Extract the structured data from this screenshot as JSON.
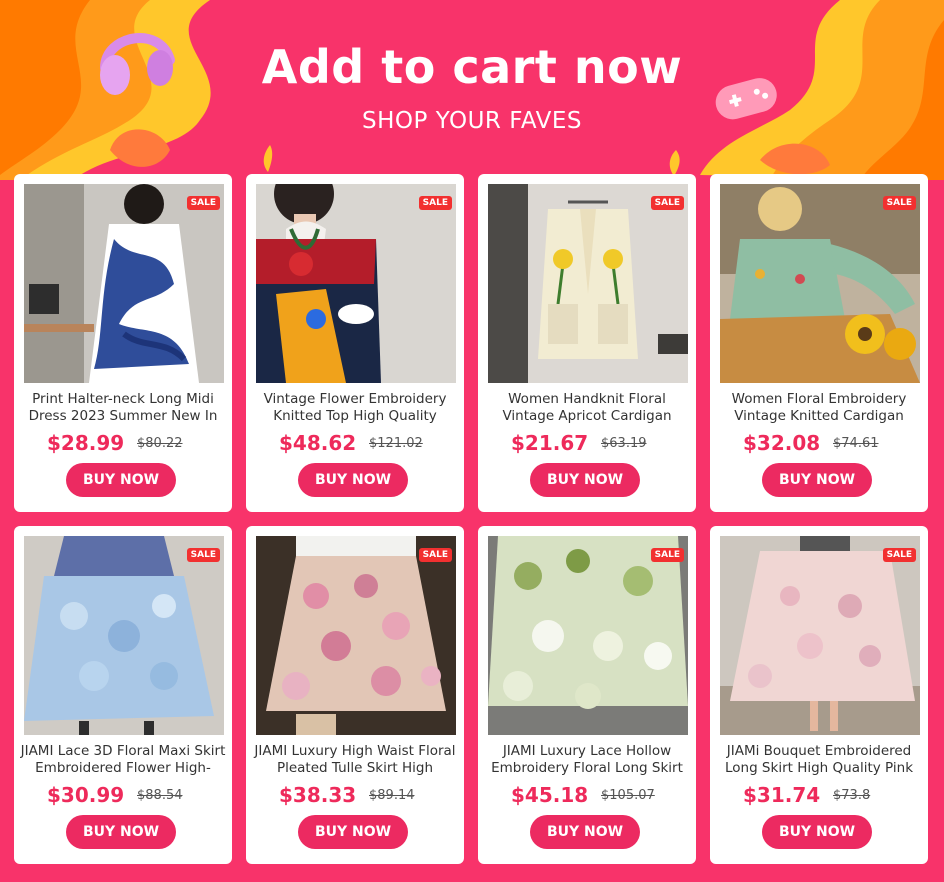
{
  "banner": {
    "title": "Add to cart now",
    "subtitle": "SHOP YOUR FAVES"
  },
  "colors": {
    "background": "#f8336a",
    "accent_orange": "#ff7a00",
    "accent_yellow": "#ffc72b",
    "price_red": "#ee2a5b",
    "button_pink": "#ec2a61"
  },
  "decorations": [
    "headphones-icon",
    "gamepad-icon",
    "leaf-icon"
  ],
  "products": [
    {
      "name": "Print Halter-neck Long Midi Dress 2023 Summer New In",
      "price": "$28.99",
      "old_price": "$80.22",
      "badge": "SALE",
      "button": "BUY NOW"
    },
    {
      "name": "Vintage Flower Embroidery Knitted Top High Quality",
      "price": "$48.62",
      "old_price": "$121.02",
      "badge": "SALE",
      "button": "BUY NOW"
    },
    {
      "name": "Women Handknit Floral Vintage Apricot Cardigan",
      "price": "$21.67",
      "old_price": "$63.19",
      "badge": "SALE",
      "button": "BUY NOW"
    },
    {
      "name": "Women Floral Embroidery Vintage Knitted Cardigan",
      "price": "$32.08",
      "old_price": "$74.61",
      "badge": "SALE",
      "button": "BUY NOW"
    },
    {
      "name": "JIAMI Lace 3D Floral Maxi Skirt Embroidered Flower High-",
      "price": "$30.99",
      "old_price": "$88.54",
      "badge": "SALE",
      "button": "BUY NOW"
    },
    {
      "name": "JIAMI Luxury High Waist Floral Pleated Tulle Skirt High",
      "price": "$38.33",
      "old_price": "$89.14",
      "badge": "SALE",
      "button": "BUY NOW"
    },
    {
      "name": "JIAMI Luxury Lace Hollow Embroidery Floral Long Skirt",
      "price": "$45.18",
      "old_price": "$105.07",
      "badge": "SALE",
      "button": "BUY NOW"
    },
    {
      "name": "JIAMi Bouquet Embroidered Long Skirt High Quality Pink",
      "price": "$31.74",
      "old_price": "$73.8",
      "badge": "SALE",
      "button": "BUY NOW"
    }
  ]
}
